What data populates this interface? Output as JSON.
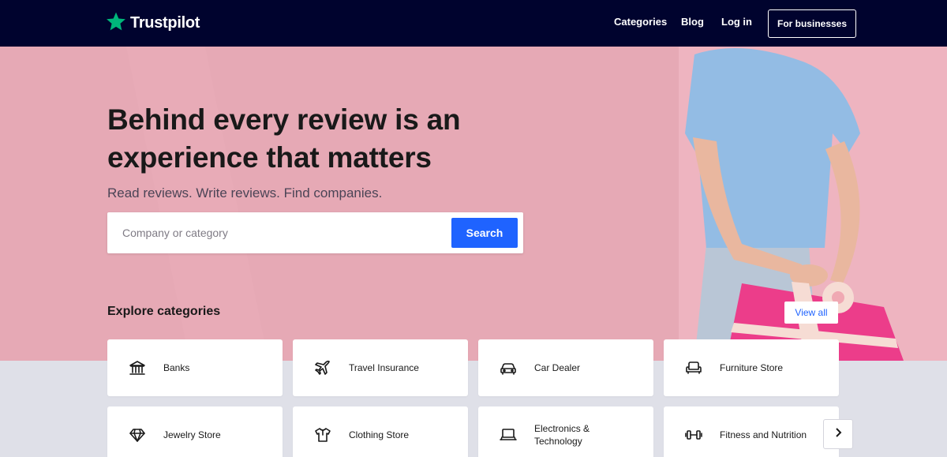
{
  "header": {
    "logo_text": "Trustpilot",
    "nav": {
      "categories": "Categories",
      "blog": "Blog",
      "login": "Log in",
      "for_businesses": "For businesses"
    }
  },
  "hero": {
    "title_line1": "Behind every review is an",
    "title_line2": "experience that matters",
    "subtitle": "Read reviews. Write reviews. Find companies.",
    "search": {
      "placeholder": "Company or category",
      "button": "Search"
    }
  },
  "explore": {
    "title": "Explore categories",
    "view_all": "View all",
    "categories": [
      {
        "label": "Banks",
        "icon": "bank-icon"
      },
      {
        "label": "Travel Insurance",
        "icon": "airplane-icon"
      },
      {
        "label": "Car Dealer",
        "icon": "car-icon"
      },
      {
        "label": "Furniture Store",
        "icon": "armchair-icon"
      },
      {
        "label": "Jewelry Store",
        "icon": "diamond-icon"
      },
      {
        "label": "Clothing Store",
        "icon": "shirt-icon"
      },
      {
        "label": "Electronics & Technology",
        "icon": "laptop-icon"
      },
      {
        "label": "Fitness and Nutrition",
        "icon": "dumbbell-icon"
      }
    ]
  },
  "colors": {
    "header_bg": "#00032e",
    "hero_bg": "#e6a9b5",
    "accent_blue": "#1f63ff",
    "brand_green": "#00b67a",
    "page_bg": "#dfe0e8"
  }
}
